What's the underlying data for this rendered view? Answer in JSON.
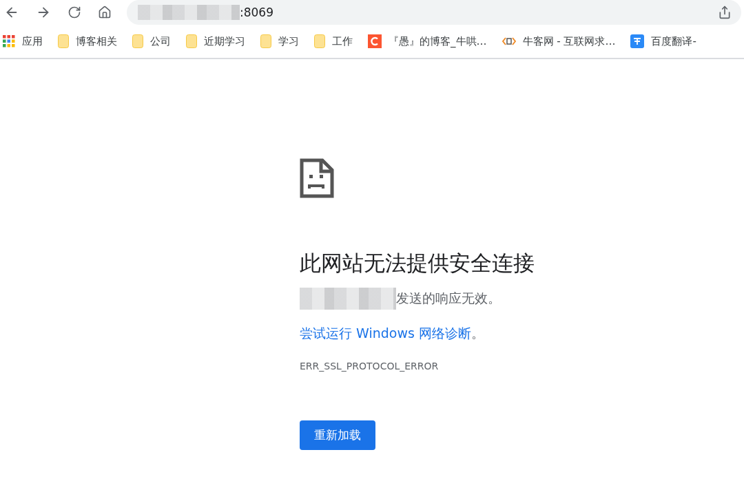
{
  "address_bar": {
    "url_suffix": ":8069",
    "redacted": true
  },
  "bookmarks": [
    {
      "kind": "apps",
      "label": "应用"
    },
    {
      "kind": "folder",
      "label": "博客相关"
    },
    {
      "kind": "folder",
      "label": "公司"
    },
    {
      "kind": "folder",
      "label": "近期学习"
    },
    {
      "kind": "folder",
      "label": "学习"
    },
    {
      "kind": "folder",
      "label": "工作"
    },
    {
      "kind": "c-logo",
      "label": "『愚』的博客_牛哄…"
    },
    {
      "kind": "code",
      "label": "牛客网 - 互联网求…"
    },
    {
      "kind": "translate",
      "label": "百度翻译-"
    }
  ],
  "error": {
    "title": "此网站无法提供安全连接",
    "message_redacted": true,
    "message": "发送的响应无效。",
    "link": "尝试运行 Windows 网络诊断",
    "link_end": "。",
    "code": "ERR_SSL_PROTOCOL_ERROR",
    "button": "重新加载"
  }
}
